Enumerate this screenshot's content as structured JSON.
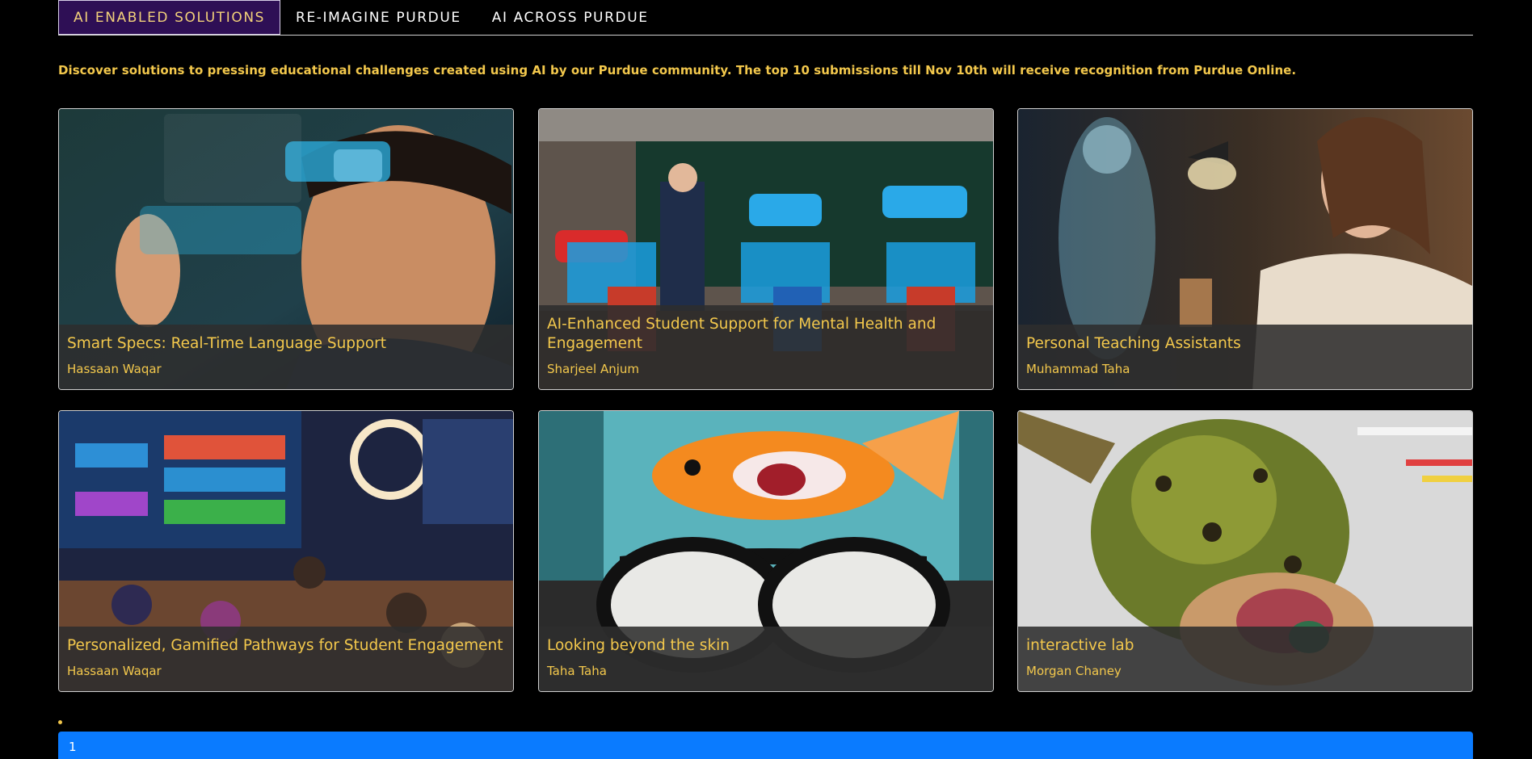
{
  "tabs": [
    {
      "label": "AI ENABLED SOLUTIONS",
      "active": true
    },
    {
      "label": "RE-IMAGINE PURDUE",
      "active": false
    },
    {
      "label": "AI ACROSS PURDUE",
      "active": false
    }
  ],
  "intro": "Discover solutions to pressing educational challenges created using AI by our Purdue community. The top 10 submissions till Nov 10th will receive recognition from Purdue Online.",
  "cards": [
    {
      "title": "Smart Specs: Real-Time Language Support",
      "author": "Hassaan Waqar"
    },
    {
      "title": "AI-Enhanced Student Support for Mental Health and Engagement",
      "author": "Sharjeel Anjum"
    },
    {
      "title": "Personal Teaching Assistants",
      "author": "Muhammad Taha"
    },
    {
      "title": "Personalized, Gamified Pathways for Student Engagement",
      "author": "Hassaan Waqar"
    },
    {
      "title": "Looking beyond the skin",
      "author": "Taha Taha"
    },
    {
      "title": "interactive lab",
      "author": "Morgan Chaney"
    }
  ],
  "pager": {
    "page": "1"
  },
  "colors": {
    "accent": "#f3c84c",
    "active_tab_bg": "#2e0f55",
    "pager_bg": "#0a7bff"
  }
}
